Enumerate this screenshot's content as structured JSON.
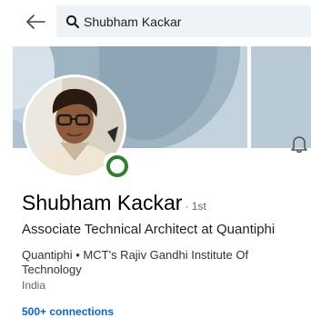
{
  "search": {
    "query": "Shubham Kackar"
  },
  "profile": {
    "name": "Shubham Kackar",
    "degree": "· 1st",
    "headline": "Associate Technical Architect at Quantiphi",
    "education": "Quantiphi • MCT's Rajiv Gandhi Institute Of Technology",
    "location": "India",
    "connections": "500+ connections",
    "status": "online"
  },
  "colors": {
    "accent": "#0a66c2",
    "online": "#2e7d32",
    "banner": "#c8d8e2",
    "search_bg": "#eef3f8"
  },
  "icons": {
    "back": "arrow-left-icon",
    "search": "search-icon",
    "notify": "bell-icon"
  }
}
